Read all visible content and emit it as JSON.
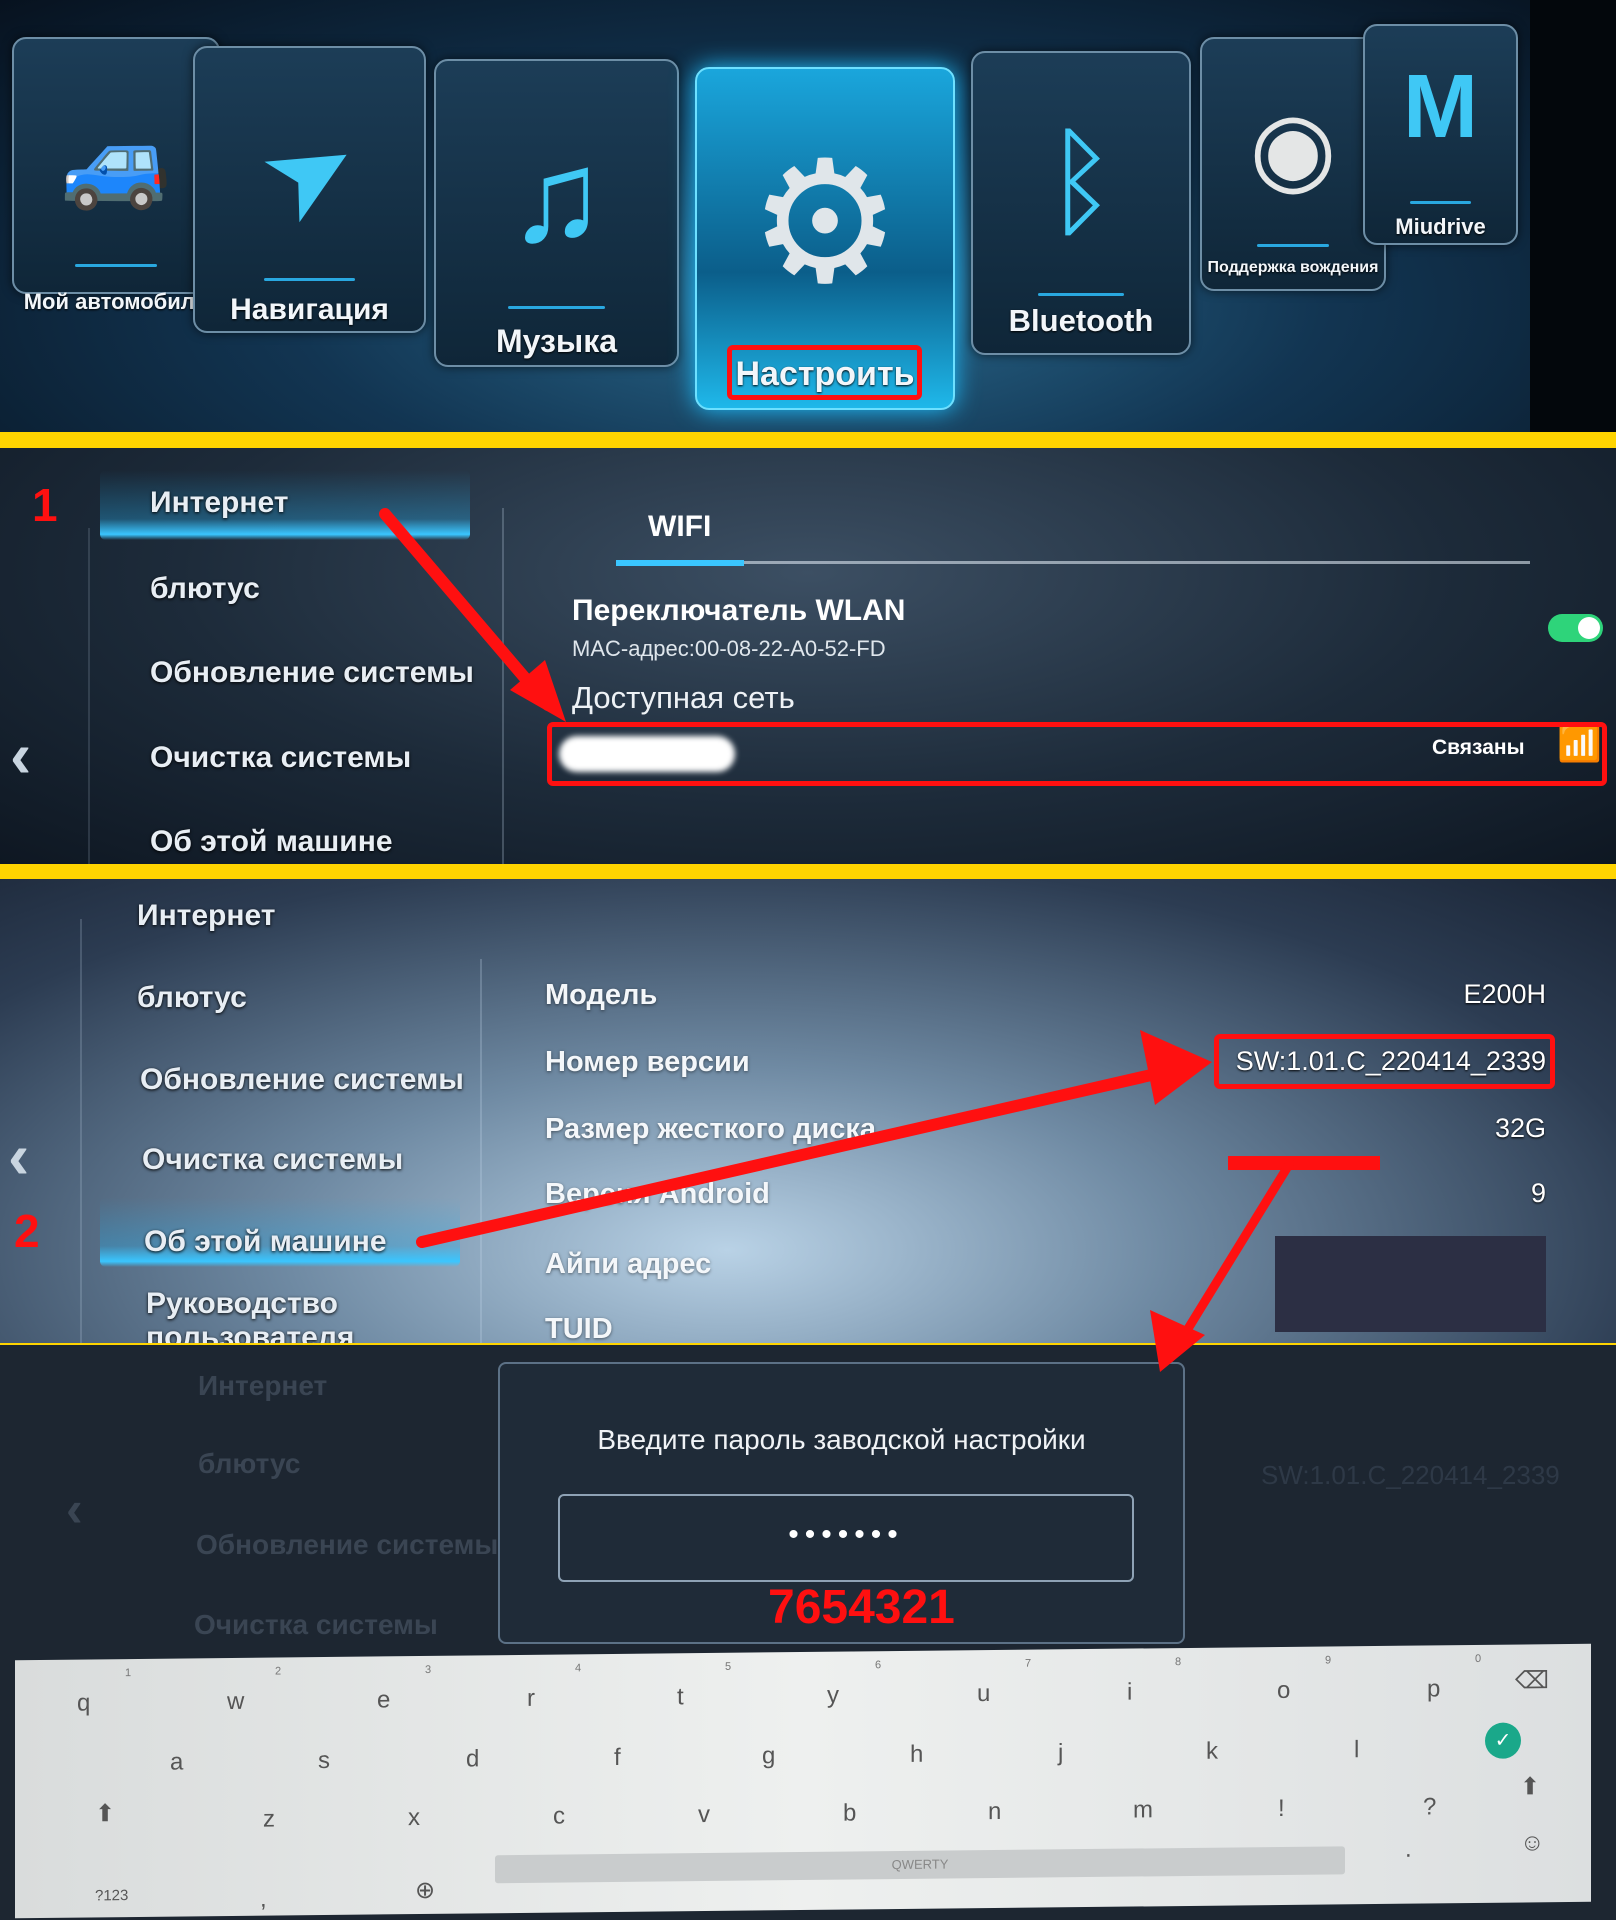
{
  "home_menu": {
    "tiles": [
      {
        "label": "Мой автомобиль",
        "icon": "car-icon"
      },
      {
        "label": "Навигация",
        "icon": "navigation-arrow-icon"
      },
      {
        "label": "Музыка",
        "icon": "music-disc-icon"
      },
      {
        "label": "Настроить",
        "icon": "gear-icon",
        "active": true
      },
      {
        "label": "Bluetooth",
        "icon": "bluetooth-phone-icon"
      },
      {
        "label": "Поддержка вождения",
        "icon": "camera-icon"
      },
      {
        "label": "Miudrive",
        "icon": "miudrive-logo-icon"
      }
    ]
  },
  "settings_wifi": {
    "step": "1",
    "sidebar": [
      "Интернет",
      "блютус",
      "Обновление системы",
      "Очистка системы",
      "Об этой машине"
    ],
    "tab": "WIFI",
    "wlan_title": "Переключатель WLAN",
    "mac": "MAC-адрес:00-08-22-A0-52-FD",
    "wlan_on": true,
    "available_label": "Доступная сеть",
    "network_status": "Связаны"
  },
  "settings_about": {
    "step": "2",
    "sidebar": [
      "Интернет",
      "блютус",
      "Обновление системы",
      "Очистка системы",
      "Об этой машине",
      "Руководство пользователя"
    ],
    "rows": [
      {
        "label": "Модель",
        "value": "E200H"
      },
      {
        "label": "Номер версии",
        "value": "SW:1.01.C_220414_2339"
      },
      {
        "label": "Размер жесткого диска",
        "value": "32G"
      },
      {
        "label": "Версия Android",
        "value": "9"
      },
      {
        "label": "Айпи адрес",
        "value": ""
      },
      {
        "label": "TUID",
        "value": ""
      }
    ]
  },
  "password_dialog": {
    "bg_sidebar": [
      "Интернет",
      "блютус",
      "Обновление системы",
      "Очистка системы"
    ],
    "bg_version": "SW:1.01.C_220414_2339",
    "title": "Введите пароль заводской настройки",
    "masked_value": "•••••••",
    "password_hint": "7654321"
  },
  "keyboard": {
    "row1": [
      "q",
      "w",
      "e",
      "r",
      "t",
      "y",
      "u",
      "i",
      "o",
      "p"
    ],
    "row1_nums": [
      "1",
      "2",
      "3",
      "4",
      "5",
      "6",
      "7",
      "8",
      "9",
      "0"
    ],
    "row2": [
      "a",
      "s",
      "d",
      "f",
      "g",
      "h",
      "j",
      "k",
      "l"
    ],
    "row3": [
      "z",
      "x",
      "c",
      "v",
      "b",
      "n",
      "m",
      "!",
      "?"
    ],
    "symbols": "?123",
    "comma": ",",
    "period": ".",
    "space": "QWERTY"
  },
  "colors": {
    "highlight": "#ff1010",
    "separator": "#ffd400",
    "accent": "#3ac6ff",
    "toggle": "#2ed47a",
    "enter": "#1aa88a"
  }
}
